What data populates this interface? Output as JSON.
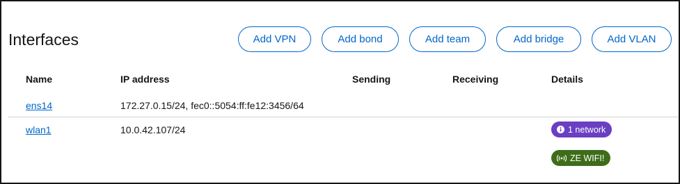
{
  "card": {
    "title": "Interfaces",
    "actions": {
      "add_vpn": "Add VPN",
      "add_bond": "Add bond",
      "add_team": "Add team",
      "add_bridge": "Add bridge",
      "add_vlan": "Add VLAN"
    }
  },
  "table": {
    "columns": [
      "Name",
      "IP address",
      "Sending",
      "Receiving",
      "Details"
    ],
    "rows": [
      {
        "name": "ens14",
        "ip": "172.27.0.15/24, fec0::5054:ff:fe12:3456/64",
        "sending": "",
        "receiving": ""
      },
      {
        "name": "wlan1",
        "ip": "10.0.42.107/24",
        "sending": "",
        "receiving": "",
        "badges": [
          {
            "icon": "info-circle-icon",
            "label": "1 network",
            "color": "#6a3fc3"
          },
          {
            "icon": "wifi-signal-icon",
            "label": "ZE WIFI!",
            "color": "#3e6d1a"
          }
        ]
      }
    ]
  },
  "colors": {
    "link": "#0066cc",
    "border": "#d2d2d2",
    "text": "#151515"
  }
}
